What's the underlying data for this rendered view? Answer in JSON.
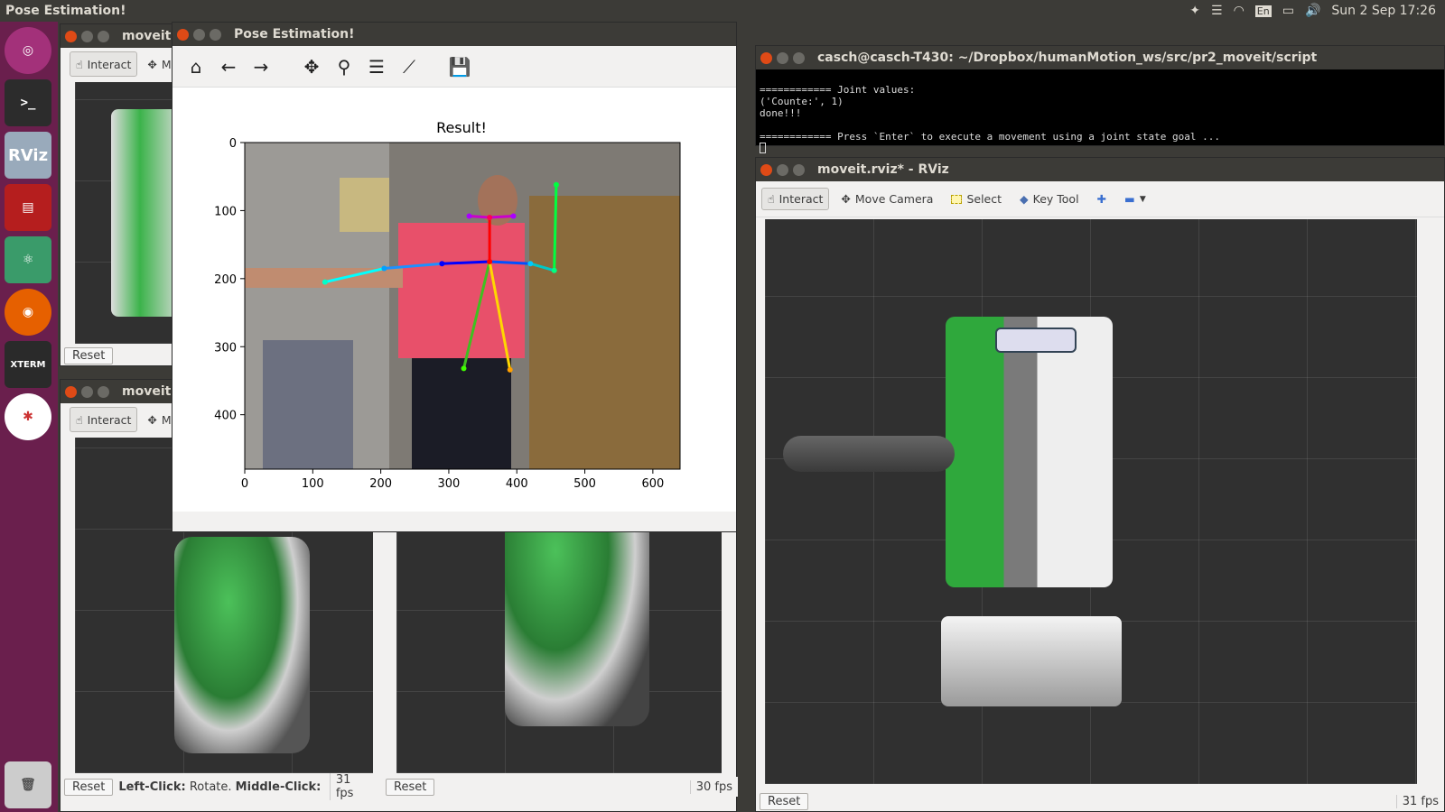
{
  "topbar": {
    "app_title": "Pose Estimation!",
    "keyboard_layout": "En",
    "datetime": "Sun 2 Sep 17:26"
  },
  "pose_window": {
    "title": "Pose Estimation!",
    "toolbar_icons": [
      "home-icon",
      "back-icon",
      "forward-icon",
      "pan-icon",
      "zoom-icon",
      "configure-icon",
      "edit-axis-icon",
      "save-icon"
    ]
  },
  "chart_data": {
    "type": "image",
    "title": "Result!",
    "xlabel": "",
    "ylabel": "",
    "xlim": [
      0,
      640
    ],
    "ylim": [
      480,
      0
    ],
    "xticks": [
      "0",
      "100",
      "200",
      "300",
      "400",
      "500",
      "600"
    ],
    "yticks": [
      "0",
      "100",
      "200",
      "300",
      "400"
    ],
    "keypoints": [
      {
        "x": 360,
        "y": 175,
        "color": "#ff0000"
      },
      {
        "x": 360,
        "y": 110,
        "color": "#ff0055"
      },
      {
        "x": 290,
        "y": 178,
        "color": "#0000ff"
      },
      {
        "x": 205,
        "y": 185,
        "color": "#00a0ff"
      },
      {
        "x": 118,
        "y": 205,
        "color": "#00ffc8"
      },
      {
        "x": 420,
        "y": 178,
        "color": "#00c8ff"
      },
      {
        "x": 455,
        "y": 188,
        "color": "#00ff80"
      },
      {
        "x": 458,
        "y": 62,
        "color": "#00ff40"
      },
      {
        "x": 322,
        "y": 332,
        "color": "#40ff00"
      },
      {
        "x": 390,
        "y": 334,
        "color": "#ffa000"
      },
      {
        "x": 330,
        "y": 108,
        "color": "#aa00ff"
      },
      {
        "x": 395,
        "y": 108,
        "color": "#aa00ff"
      }
    ],
    "limbs": [
      {
        "from": 1,
        "to": 0,
        "color": "#ff0000"
      },
      {
        "from": 0,
        "to": 2,
        "color": "#0000ff"
      },
      {
        "from": 2,
        "to": 3,
        "color": "#1e90ff"
      },
      {
        "from": 3,
        "to": 4,
        "color": "#00ffff"
      },
      {
        "from": 0,
        "to": 5,
        "color": "#0050ff"
      },
      {
        "from": 5,
        "to": 6,
        "color": "#00c8c8"
      },
      {
        "from": 6,
        "to": 7,
        "color": "#00ff40"
      },
      {
        "from": 0,
        "to": 8,
        "color": "#40c020"
      },
      {
        "from": 0,
        "to": 9,
        "color": "#ffd700"
      },
      {
        "from": 1,
        "to": 10,
        "color": "#cc00cc"
      },
      {
        "from": 1,
        "to": 11,
        "color": "#cc00cc"
      }
    ]
  },
  "terminal": {
    "title": "casch@casch-T430: ~/Dropbox/humanMotion_ws/src/pr2_moveit/script",
    "lines": [
      "============ Joint values:",
      "('Counte:', 1)",
      "done!!!",
      "",
      "============ Press `Enter` to execute a movement using a joint state goal ..."
    ]
  },
  "rviz_main": {
    "title": "moveit.rviz* - RViz",
    "tools": [
      "Interact",
      "Move Camera",
      "Select",
      "Key Tool"
    ],
    "reset": "Reset",
    "fps": "31 fps"
  },
  "rviz_back": {
    "title": "moveit.",
    "interact": "Interact",
    "move_cut": "M",
    "reset": "Reset",
    "hint_bold1": "Left-Click:",
    "hint_text1": " Rotate. ",
    "hint_bold2": "Middle-Click:",
    "hint_text2": " M",
    "fps_left": "31 fps",
    "fps_mid": "30 fps"
  },
  "launcher": {
    "items": [
      "ubuntu-icon",
      "terminal-icon",
      "rviz-icon",
      "presentation-icon",
      "atom-icon",
      "firefox-icon",
      "xterm-icon",
      "pinwheel-icon",
      "trash-icon"
    ]
  }
}
